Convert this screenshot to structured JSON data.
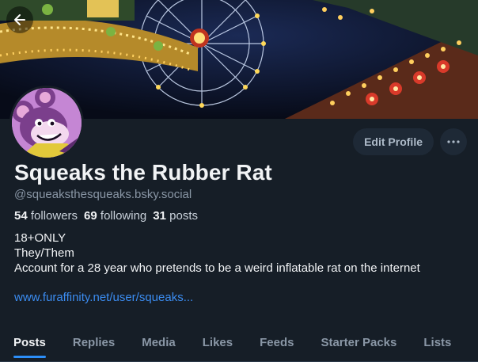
{
  "profile": {
    "display_name": "Squeaks the Rubber Rat",
    "handle": "@squeaksthesqueaks.bsky.social",
    "followers_count": "54",
    "followers_label": "followers",
    "following_count": "69",
    "following_label": "following",
    "posts_count": "31",
    "posts_label": "posts",
    "bio_lines": [
      "18+ONLY",
      "They/Them",
      "Account for a 28 year who pretends to be a weird inflatable rat on the internet"
    ],
    "link": "www.furaffinity.net/user/squeaks..."
  },
  "actions": {
    "edit_label": "Edit Profile",
    "more_icon": "ellipsis-icon"
  },
  "nav": {
    "back_icon": "arrow-left-icon"
  },
  "tabs": [
    "Posts",
    "Replies",
    "Media",
    "Likes",
    "Feeds",
    "Starter Packs",
    "Lists"
  ],
  "colors": {
    "accent": "#2c8ef8",
    "link": "#3b8cf0",
    "background": "#161e27"
  }
}
